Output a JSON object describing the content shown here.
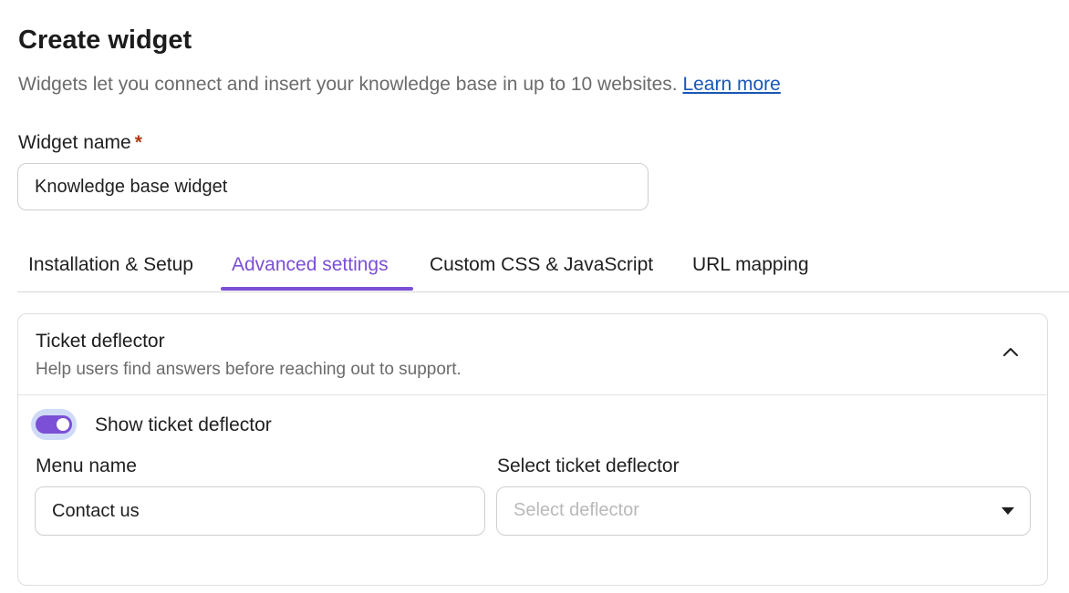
{
  "page": {
    "title": "Create widget",
    "subtitle": "Widgets let you connect and insert your knowledge base in up to 10 websites.",
    "learn_more": "Learn more"
  },
  "widget_name": {
    "label": "Widget name",
    "required_marker": "*",
    "value": "Knowledge base widget"
  },
  "tabs": [
    {
      "label": "Installation & Setup",
      "active": false
    },
    {
      "label": "Advanced settings",
      "active": true
    },
    {
      "label": "Custom CSS & JavaScript",
      "active": false
    },
    {
      "label": "URL mapping",
      "active": false
    }
  ],
  "ticket_deflector": {
    "title": "Ticket deflector",
    "description": "Help users find answers before reaching out to support.",
    "expanded": true,
    "toggle_label": "Show ticket deflector",
    "toggle_on": true,
    "menu_name_label": "Menu name",
    "menu_name_value": "Contact us",
    "select_label": "Select ticket deflector",
    "select_placeholder": "Select deflector"
  },
  "icons": {
    "collapse": "chevron-up-icon",
    "dropdown": "caret-down-icon"
  },
  "colors": {
    "accent": "#7b4fd6",
    "link": "#1857b6",
    "required": "#b33a12",
    "muted_text": "#6b6b6b",
    "toggle_halo": "#cfdbf6"
  }
}
